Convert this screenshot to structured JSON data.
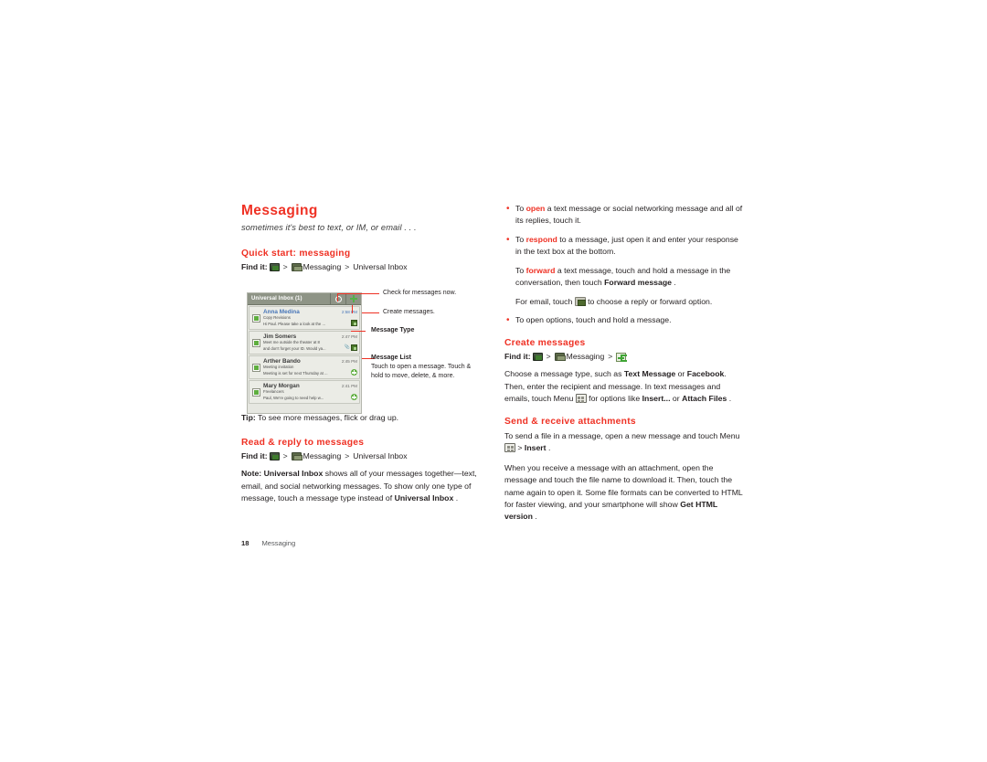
{
  "colors": {
    "accent": "#ef3124",
    "body_text": "#231f20",
    "phone_header": "#8e9486"
  },
  "chapter": {
    "title": "Messaging",
    "subtitle": "sometimes it's best to text, or IM, or email . . ."
  },
  "sections": {
    "quick_start": {
      "heading": "Quick start: messaging",
      "findit_label": "Find it:",
      "findit_app": "Messaging",
      "findit_target": "Universal Inbox",
      "sep": ">",
      "tip_label": "Tip:",
      "tip_text": "To see more messages, flick or drag up."
    },
    "read_reply": {
      "heading": "Read & reply to messages",
      "findit_label": "Find it:",
      "findit_app": "Messaging",
      "findit_target": "Universal Inbox",
      "sep": ">",
      "note_label": "Note:",
      "note_p1_a": "Universal Inbox",
      "note_p1_b": " shows all of your messages together—text, email, and social networking messages. To show only one type of message, touch a message type instead of ",
      "note_p1_c": "Universal Inbox",
      "note_p1_d": " ."
    },
    "bullets": [
      {
        "pre": "To ",
        "red": "open",
        "post": " a text message or social networking message and all of its replies, touch it."
      },
      {
        "pre": "To ",
        "red": "respond",
        "post": " to a message, just open it and enter your response in the text box at the bottom."
      },
      {
        "pre": "To open options, touch and hold a message.",
        "red": "",
        "post": ""
      }
    ],
    "forward_para": {
      "pre": "To ",
      "red": "forward",
      "mid": " a text message, touch and hold a message in the conversation, then touch ",
      "bold": "Forward message",
      "post": " ."
    },
    "email_para": {
      "pre": "For email, touch ",
      "post": " to choose a reply or forward option."
    },
    "create_messages": {
      "heading": "Create messages",
      "findit_label": "Find it:",
      "findit_app": "Messaging",
      "sep": ">",
      "p1_a": "Choose a message type, such as ",
      "p1_b": "Text Message",
      "p1_c": " or ",
      "p1_d": "Facebook",
      "p1_e": ". Then, enter the recipient and message. In text messages and emails, touch Menu ",
      "p1_f": " for options like ",
      "p1_g": "Insert...",
      "p1_h": " or ",
      "p1_i": "Attach Files",
      "p1_j": " ."
    },
    "attachments": {
      "heading": "Send & receive attachments",
      "p1_a": "To send a file in a message, open a new message and touch Menu ",
      "p1_b": " > ",
      "p1_c": "Insert",
      "p1_d": " .",
      "p2_a": "When you receive a message with an attachment, open the message and touch the file name to download it. Then, touch the name again to open it. Some file formats can be converted to HTML for faster viewing, and your smartphone will show ",
      "p2_b": "Get HTML version",
      "p2_c": " ."
    }
  },
  "phone": {
    "header_title": "Universal Inbox (1)",
    "refresh_icon": "refresh-icon",
    "compose_icon": "plus-icon",
    "messages": [
      {
        "sender": "Anna Medina",
        "time": "2:58 PM",
        "subject": "Copy Revisions",
        "snippet": "Hi Paul. Please take a look at the ...",
        "unread": true,
        "badges": [
          "message-type"
        ]
      },
      {
        "sender": "Jim Somers",
        "time": "2:47 PM",
        "subject": "Meet me outside the theater at 8",
        "snippet": "and don't forget your ID. Would ya...",
        "unread": false,
        "badges": [
          "attachment",
          "message-type"
        ]
      },
      {
        "sender": "Arther Bando",
        "time": "2:45 PM",
        "subject": "Meeting invitation",
        "snippet": "Meeting is set for next Thursday at ...",
        "unread": false,
        "badges": [
          "social"
        ]
      },
      {
        "sender": "Mary Morgan",
        "time": "2:41 PM",
        "subject": "Freelancers",
        "snippet": "Paul, We're going to need help w...",
        "unread": false,
        "badges": [
          "social"
        ]
      }
    ]
  },
  "callouts": {
    "check_messages": "Check for messages now.",
    "create_messages": "Create messages.",
    "message_type": "Message Type",
    "message_list_title": "Message List",
    "message_list_body": "Touch to open a message. Touch & hold to move, delete, & more."
  },
  "footer": {
    "page_number": "18",
    "chapter_name": "Messaging"
  }
}
